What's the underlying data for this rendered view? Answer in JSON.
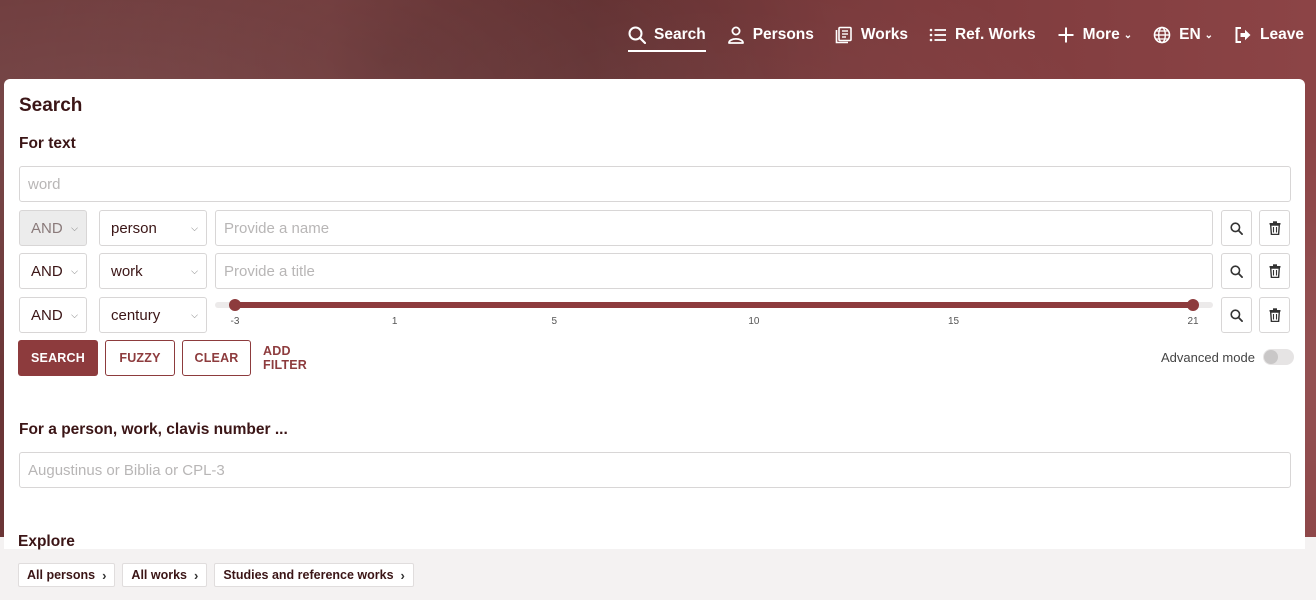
{
  "nav": {
    "search": "Search",
    "persons": "Persons",
    "works": "Works",
    "ref_works": "Ref. Works",
    "more": "More",
    "language": "EN",
    "leave": "Leave"
  },
  "search": {
    "title": "Search",
    "for_text_label": "For text",
    "word_placeholder": "word",
    "rows": [
      {
        "operator": "AND",
        "field": "person",
        "placeholder": "Provide a name"
      },
      {
        "operator": "AND",
        "field": "work",
        "placeholder": "Provide a title"
      },
      {
        "operator": "AND",
        "field": "century",
        "range": [
          -3,
          21
        ],
        "ticks": [
          "-3",
          "1",
          "5",
          "10",
          "15",
          "21"
        ]
      }
    ],
    "buttons": {
      "search": "SEARCH",
      "fuzzy": "FUZZY",
      "clear": "CLEAR",
      "add_filter": "ADD FILTER"
    },
    "advanced_mode_label": "Advanced mode",
    "advanced_mode_on": false
  },
  "lookup": {
    "label": "For a person, work, clavis number ...",
    "placeholder": "Augustinus or Biblia or CPL-3"
  },
  "explore": {
    "title": "Explore",
    "chips": [
      "All persons",
      "All works",
      "Studies and reference works"
    ]
  },
  "colors": {
    "accent": "#8d3b3d",
    "heading": "#3b1516"
  }
}
